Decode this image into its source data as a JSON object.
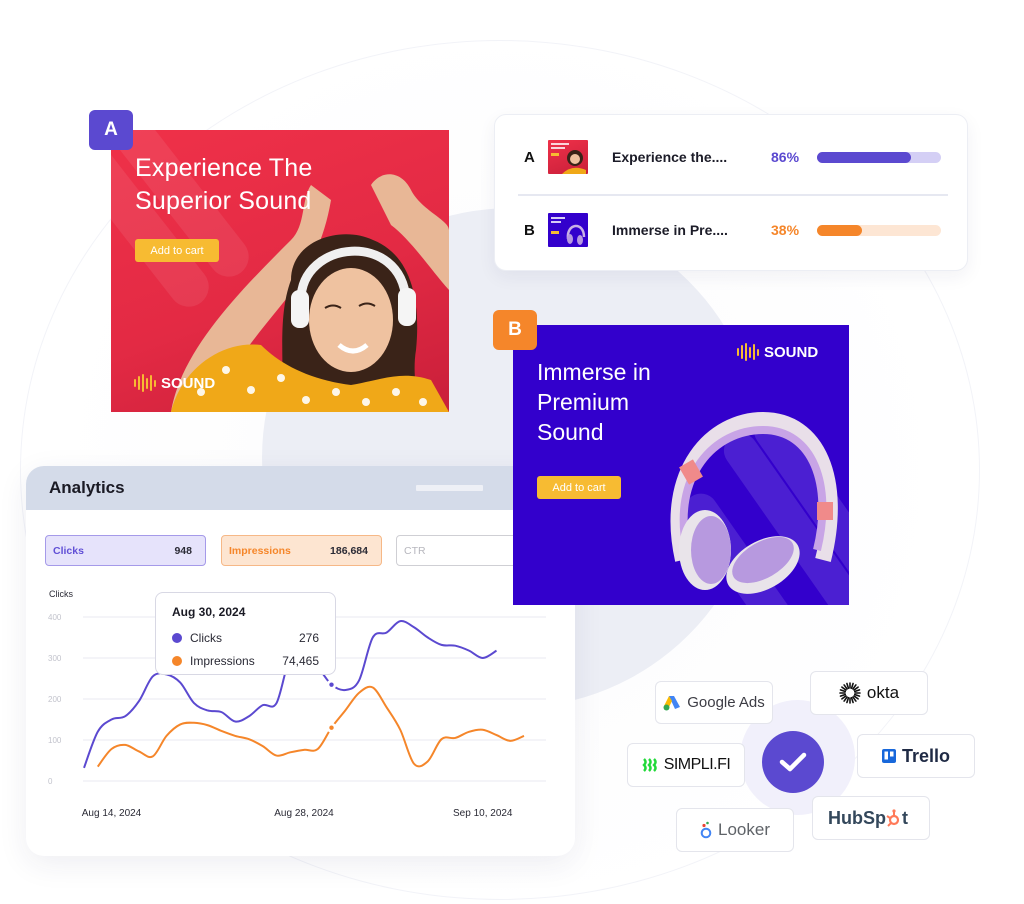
{
  "ads": {
    "a": {
      "badge": "A",
      "headline_line1": "Experience The",
      "headline_line2": "Superior Sound",
      "cta": "Add to cart",
      "brand": "SOUND",
      "bg_color": "#e32a44"
    },
    "b": {
      "badge": "B",
      "headline_line1": "Immerse in",
      "headline_line2": "Premium",
      "headline_line3": "Sound",
      "cta": "Add to cart",
      "brand": "SOUND",
      "bg_color": "#3300cc"
    }
  },
  "comparison": {
    "rows": [
      {
        "letter": "A",
        "name": "Experience the....",
        "percent_label": "86%",
        "percent": 86,
        "bar_fill_fraction": 0.76,
        "color": "#5b49d0",
        "track_color": "#d4cff5"
      },
      {
        "letter": "B",
        "name": "Immerse in Pre....",
        "percent_label": "38%",
        "percent": 38,
        "bar_fill_fraction": 0.36,
        "color": "#f5862a",
        "track_color": "#fde6d4"
      }
    ]
  },
  "analytics": {
    "title": "Analytics",
    "metrics": [
      {
        "label": "Clicks",
        "value": "948"
      },
      {
        "label": "Impressions",
        "value": "186,684"
      },
      {
        "label": "CTR",
        "value": ""
      }
    ],
    "tooltip": {
      "date": "Aug 30, 2024",
      "rows": [
        {
          "name": "Clicks",
          "value": "276",
          "color": "#5b49d0"
        },
        {
          "name": "Impressions",
          "value": "74,465",
          "color": "#f5862a"
        }
      ]
    }
  },
  "chart_data": {
    "type": "line",
    "title": "",
    "ylabel": "Clicks",
    "xlabel": "",
    "ylim": [
      0,
      400
    ],
    "yticks": [
      0,
      100,
      200,
      300,
      400
    ],
    "xtick_labels": [
      "Aug 14, 2024",
      "Aug 28, 2024",
      "Sep 10, 2024"
    ],
    "xtick_days": [
      2,
      16,
      29
    ],
    "grid": true,
    "legend": "none",
    "highlight_day": 18,
    "x": [
      "Aug 12",
      "Aug 13",
      "Aug 14",
      "Aug 15",
      "Aug 16",
      "Aug 17",
      "Aug 18",
      "Aug 19",
      "Aug 20",
      "Aug 21",
      "Aug 22",
      "Aug 23",
      "Aug 24",
      "Aug 25",
      "Aug 26",
      "Aug 27",
      "Aug 28",
      "Aug 29",
      "Aug 30",
      "Aug 31",
      "Sep 1",
      "Sep 2",
      "Sep 3",
      "Sep 4",
      "Sep 5",
      "Sep 6",
      "Sep 7",
      "Sep 8",
      "Sep 9",
      "Sep 10",
      "Sep 11",
      "Sep 12",
      "Sep 13"
    ],
    "series": [
      {
        "name": "Clicks",
        "color": "#5b49d0",
        "values": [
          32,
          120,
          150,
          158,
          195,
          255,
          260,
          240,
          190,
          172,
          168,
          145,
          158,
          185,
          190,
          300,
          290,
          276,
          235,
          222,
          245,
          350,
          362,
          390,
          375,
          350,
          332,
          330,
          318,
          300,
          318,
          null,
          null
        ]
      },
      {
        "name": "Impressions",
        "color": "#f5862a",
        "values": [
          null,
          35,
          78,
          88,
          72,
          60,
          110,
          138,
          142,
          136,
          122,
          110,
          102,
          85,
          62,
          70,
          76,
          78,
          130,
          172,
          215,
          228,
          180,
          125,
          42,
          48,
          102,
          105,
          120,
          125,
          112,
          98,
          110
        ]
      }
    ]
  },
  "integrations": {
    "items": [
      {
        "name": "Google Ads"
      },
      {
        "name": "okta"
      },
      {
        "name": "SIMPLI.FI"
      },
      {
        "name": "Trello"
      },
      {
        "name": "Looker"
      },
      {
        "name": "HubSpot"
      }
    ],
    "center_icon": "check-icon",
    "accent": "#5b49d0"
  }
}
